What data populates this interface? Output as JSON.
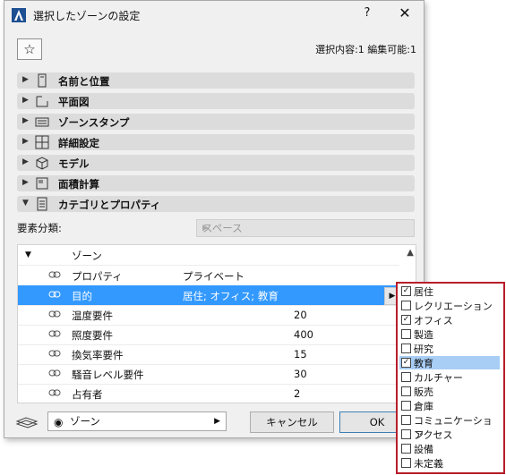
{
  "window": {
    "title": "選択したゾーンの設定",
    "help": "?",
    "close": "✕"
  },
  "favorites": {
    "icon": "star-icon",
    "glyph": "☆"
  },
  "selection_info": "選択内容:1 編集可能:1",
  "panels": [
    {
      "label": "名前と位置",
      "icon": "name-position-icon"
    },
    {
      "label": "平面図",
      "icon": "floor-plan-icon"
    },
    {
      "label": "ゾーンスタンプ",
      "icon": "zone-stamp-icon"
    },
    {
      "label": "詳細設定",
      "icon": "detail-settings-icon"
    },
    {
      "label": "モデル",
      "icon": "model-icon"
    },
    {
      "label": "面積計算",
      "icon": "area-calc-icon"
    },
    {
      "label": "カテゴリとプロパティ",
      "icon": "category-properties-icon"
    }
  ],
  "classification": {
    "label": "要素分類:",
    "value": "スペース"
  },
  "table": {
    "group": "ゾーン",
    "rows": [
      {
        "name": "プロパティ",
        "value": "プライベート",
        "num": ""
      },
      {
        "name": "目的",
        "value": "居住; オフィス; 教育",
        "num": ""
      },
      {
        "name": "温度要件",
        "value": "",
        "num": "20"
      },
      {
        "name": "照度要件",
        "value": "",
        "num": "400"
      },
      {
        "name": "換気率要件",
        "value": "",
        "num": "15"
      },
      {
        "name": "騒音レベル要件",
        "value": "",
        "num": "30"
      },
      {
        "name": "占有者",
        "value": "",
        "num": "2"
      }
    ]
  },
  "footer": {
    "view": "ゾーン",
    "cancel": "キャンセル",
    "ok": "OK"
  },
  "popup": {
    "options": [
      {
        "label": "居住",
        "checked": true
      },
      {
        "label": "レクリエーション",
        "checked": false
      },
      {
        "label": "オフィス",
        "checked": true
      },
      {
        "label": "製造",
        "checked": false
      },
      {
        "label": "研究",
        "checked": false
      },
      {
        "label": "教育",
        "checked": true,
        "highlighted": true
      },
      {
        "label": "カルチャー",
        "checked": false
      },
      {
        "label": "販売",
        "checked": false
      },
      {
        "label": "倉庫",
        "checked": false
      },
      {
        "label": "コミュニケーション",
        "checked": false
      },
      {
        "label": "アクセス",
        "checked": false
      },
      {
        "label": "設備",
        "checked": false
      },
      {
        "label": "未定義",
        "checked": false
      }
    ]
  },
  "colors": {
    "selected_row": "#3399ff",
    "popup_border": "#b81d2a",
    "highlight": "#a8cef5"
  }
}
